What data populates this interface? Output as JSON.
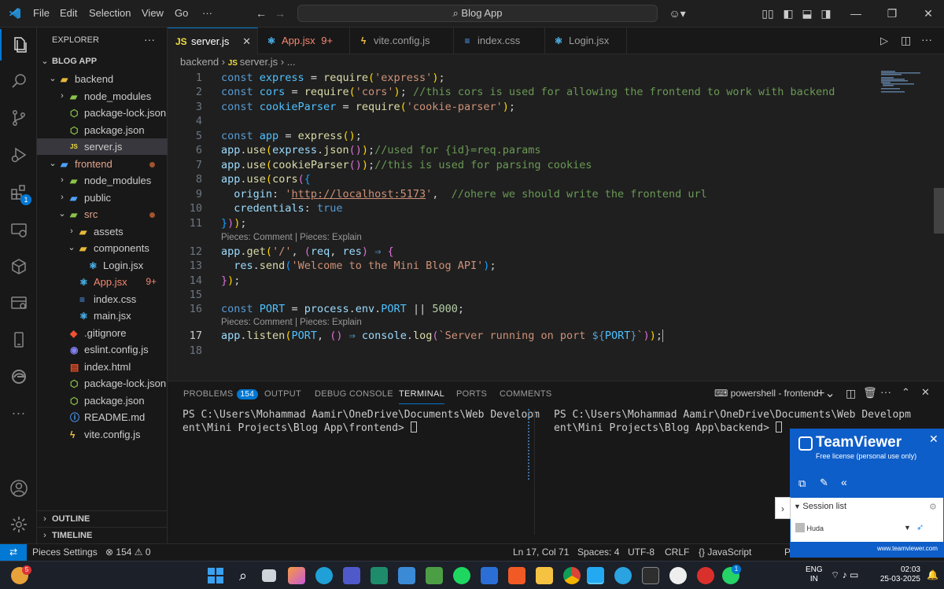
{
  "titlebar": {
    "menus": [
      "File",
      "Edit",
      "Selection",
      "View",
      "Go",
      "···"
    ],
    "search_text": "Blog App"
  },
  "explorer": {
    "header": "EXPLORER",
    "root": "BLOG APP",
    "items": [
      {
        "label": "backend",
        "kind": "folder-open",
        "depth": 1
      },
      {
        "label": "node_modules",
        "kind": "folder",
        "depth": 2
      },
      {
        "label": "package-lock.json",
        "kind": "json",
        "depth": 2
      },
      {
        "label": "package.json",
        "kind": "json",
        "depth": 2
      },
      {
        "label": "server.js",
        "kind": "js",
        "depth": 2,
        "selected": true
      },
      {
        "label": "frontend",
        "kind": "folder-open",
        "depth": 1,
        "modified": true
      },
      {
        "label": "node_modules",
        "kind": "folder",
        "depth": 2
      },
      {
        "label": "public",
        "kind": "folder",
        "depth": 2
      },
      {
        "label": "src",
        "kind": "folder-open",
        "depth": 2,
        "modified": true
      },
      {
        "label": "assets",
        "kind": "folder",
        "depth": 3
      },
      {
        "label": "components",
        "kind": "folder-open",
        "depth": 3
      },
      {
        "label": "Login.jsx",
        "kind": "react",
        "depth": 4
      },
      {
        "label": "App.jsx",
        "kind": "react",
        "depth": 3,
        "badge": "9+"
      },
      {
        "label": "index.css",
        "kind": "css",
        "depth": 3
      },
      {
        "label": "main.jsx",
        "kind": "react",
        "depth": 3
      },
      {
        "label": ".gitignore",
        "kind": "git",
        "depth": 2
      },
      {
        "label": "eslint.config.js",
        "kind": "eslint",
        "depth": 2
      },
      {
        "label": "index.html",
        "kind": "html",
        "depth": 2
      },
      {
        "label": "package-lock.json",
        "kind": "json",
        "depth": 2
      },
      {
        "label": "package.json",
        "kind": "json",
        "depth": 2
      },
      {
        "label": "README.md",
        "kind": "info",
        "depth": 2
      },
      {
        "label": "vite.config.js",
        "kind": "vite",
        "depth": 2
      }
    ],
    "outline": "OUTLINE",
    "timeline": "TIMELINE",
    "extensions_badge": "1"
  },
  "tabs": [
    {
      "label": "server.js",
      "icon": "js",
      "active": true
    },
    {
      "label": "App.jsx",
      "icon": "react",
      "badge": "9+"
    },
    {
      "label": "vite.config.js",
      "icon": "vite"
    },
    {
      "label": "index.css",
      "icon": "css"
    },
    {
      "label": "Login.jsx",
      "icon": "react"
    }
  ],
  "breadcrumb": {
    "parts": [
      "backend",
      "server.js",
      "..."
    ]
  },
  "code_lens": "Pieces: Comment | Pieces: Explain",
  "line_numbers": [
    "1",
    "2",
    "3",
    "4",
    "5",
    "6",
    "7",
    "8",
    "9",
    "10",
    "11",
    "12",
    "13",
    "14",
    "15",
    "16",
    "17",
    "18"
  ],
  "panel": {
    "tabs": [
      "PROBLEMS",
      "OUTPUT",
      "DEBUG CONSOLE",
      "TERMINAL",
      "PORTS",
      "COMMENTS"
    ],
    "problems_count": "154",
    "terminal_name": "powershell - frontend",
    "term_left": [
      "PS C:\\Users\\Mohammad Aamir\\OneDrive\\Documents\\Web Developm",
      "ent\\Mini Projects\\Blog App\\frontend> "
    ],
    "term_right": [
      "PS C:\\Users\\Mohammad Aamir\\OneDrive\\Documents\\Web Developm",
      "ent\\Mini Projects\\Blog App\\backend> "
    ]
  },
  "statusbar": {
    "pieces": "Pieces Settings",
    "problems": "⊗ 154 ⚠ 0",
    "position": "Ln 17, Col 71",
    "spaces": "Spaces: 4",
    "encoding": "UTF-8",
    "eol": "CRLF",
    "language": "JavaScript",
    "letter": "P"
  },
  "teamviewer": {
    "brand": "TeamViewer",
    "license": "Free license (personal use only)",
    "session_list": "Session list",
    "user": "Huda",
    "url": "www.teamviewer.com"
  },
  "taskbar": {
    "lang": "ENG",
    "region": "IN",
    "time": "02:03",
    "date": "25-03-2025",
    "notif": "5",
    "whatsapp_badge": "1"
  }
}
